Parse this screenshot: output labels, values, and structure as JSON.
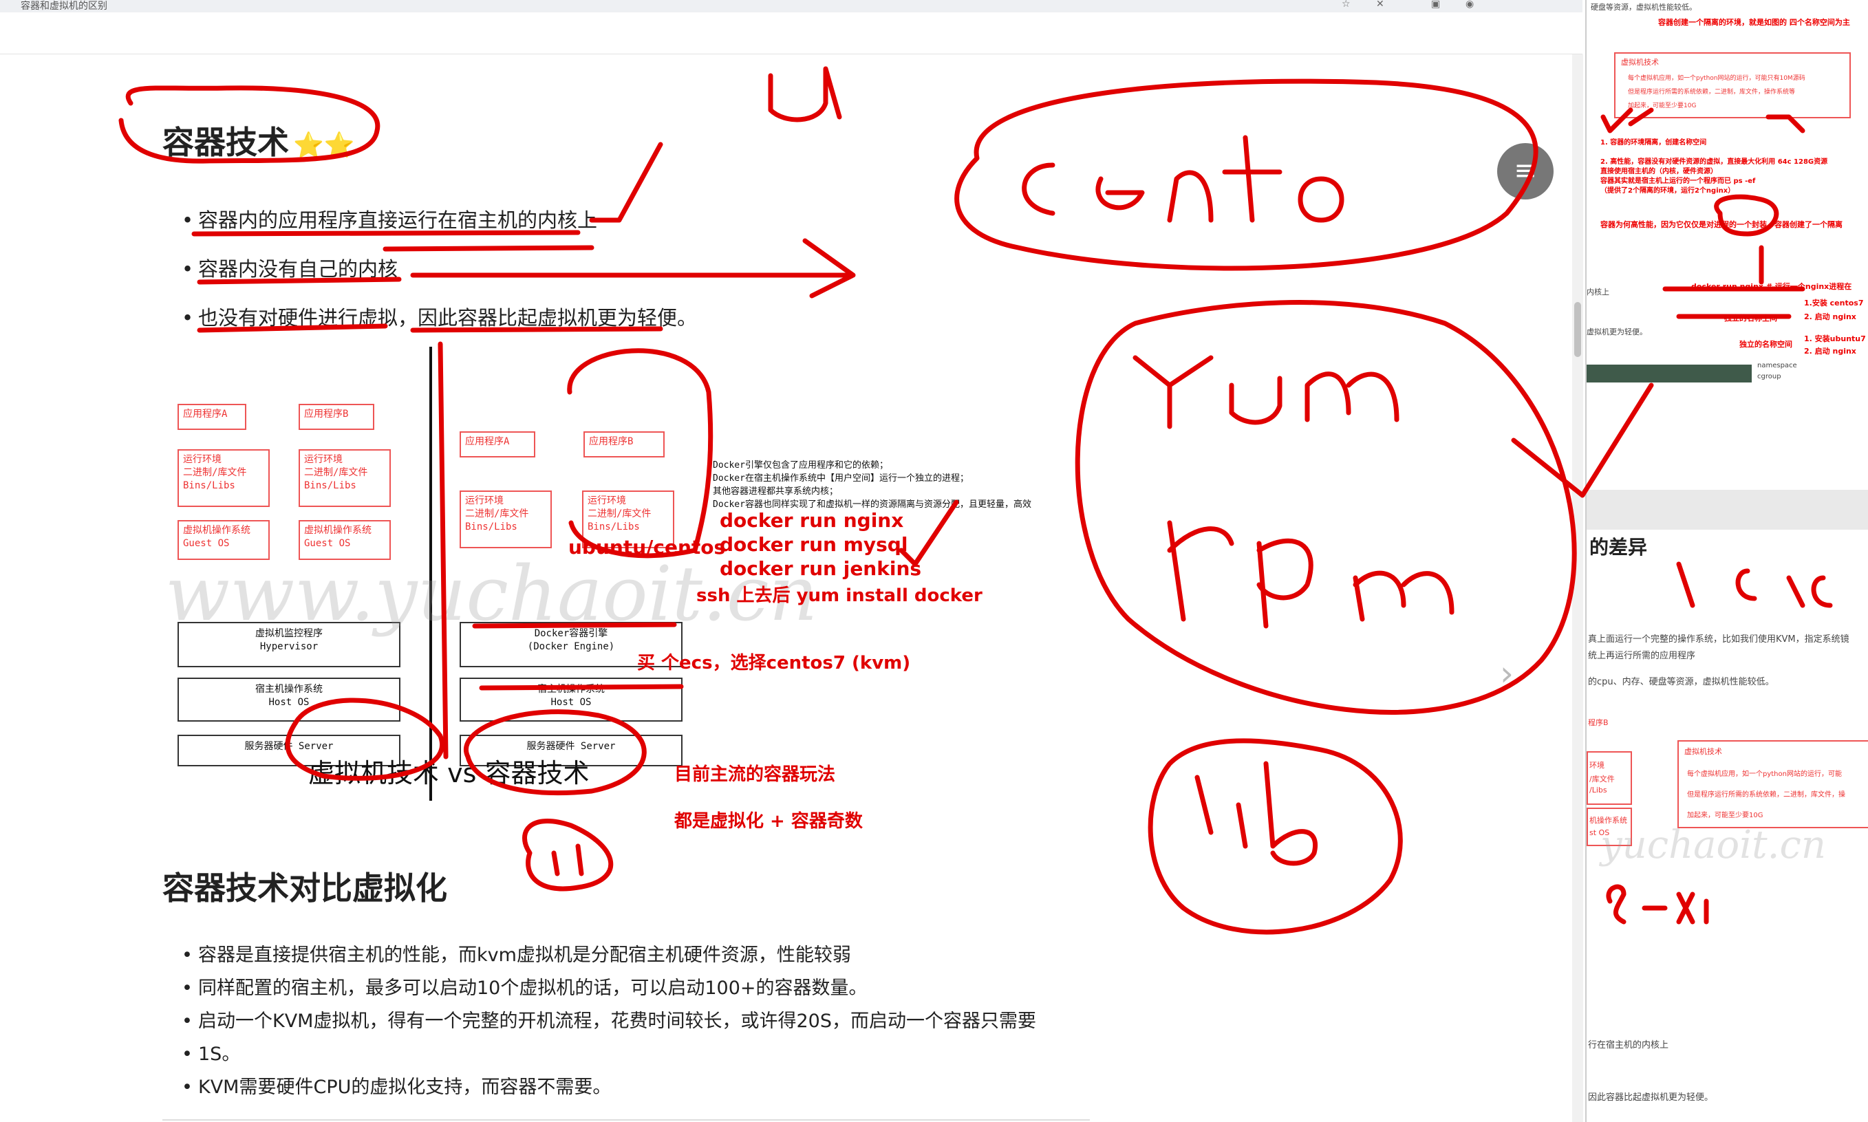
{
  "browser": {
    "tab_title": "容器和虚拟机的区别",
    "icons": [
      "star-icon",
      "close-icon",
      "extension-icon",
      "profile-icon"
    ]
  },
  "section1": {
    "title": "容器技术",
    "stars": "⭐⭐",
    "bullets": [
      "容器内的应用程序直接运行在宿主机的内核上",
      "容器内没有自己的内核",
      "也没有对硬件进行虚拟，因此容器比起虚拟机更为轻便。"
    ]
  },
  "diagram": {
    "left": {
      "app_a": "应用程序A",
      "app_b": "应用程序B",
      "env_a": [
        "运行环境",
        "二进制/库文件",
        "Bins/Libs"
      ],
      "env_b": [
        "运行环境",
        "二进制/库文件",
        "Bins/Libs"
      ],
      "guest_a": [
        "虚拟机操作系统",
        "Guest OS"
      ],
      "guest_b": [
        "虚拟机操作系统",
        "Guest OS"
      ],
      "hypervisor": [
        "虚拟机监控程序",
        "Hypervisor"
      ],
      "host": [
        "宿主机操作系统",
        "Host OS"
      ],
      "server": "服务器硬件 Server"
    },
    "right": {
      "app_a": "应用程序A",
      "app_b": "应用程序B",
      "env_a": [
        "运行环境",
        "二进制/库文件",
        "Bins/Libs"
      ],
      "env_b": [
        "运行环境",
        "二进制/库文件",
        "Bins/Libs"
      ],
      "engine": [
        "Docker容器引擎",
        "(Docker Engine)"
      ],
      "host": [
        "宿主机操作系统",
        "Host OS"
      ],
      "server": "服务器硬件 Server"
    },
    "notes": [
      "Docker引擎仅包含了应用程序和它的依赖；",
      "Docker在宿主机操作系统中【用户空间】运行一个独立的进程；",
      "其他容器进程都共享系统内核；",
      "Docker容器也同样实现了和虚拟机一样的资源隔离与资源分配，且更轻量，高效"
    ],
    "caption": "虚拟机技术 vs 容器技术",
    "watermark": "www.yuchaoit.cn"
  },
  "annotations": {
    "ubuntu": "ubuntu/centos",
    "cmds": [
      "docker run nginx",
      "docker run mysql",
      "docker run jenkins"
    ],
    "ssh": "ssh 上去后  yum install docker",
    "buy": "买 个ecs，选择centos7  (kvm)",
    "mainstream": "目前主流的容器玩法",
    "virt": "都是虚拟化 + 容器奇数",
    "hand_centos": "centos",
    "hand_yum": "yum",
    "hand_rpm": "rpm",
    "hand_lib": "lib",
    "hand_u": "u",
    "hand_esxi": "esxi"
  },
  "section2": {
    "title": "容器技术对比虚拟化",
    "bullets": [
      "容器是直接提供宿主机的性能，而kvm虚拟机是分配宿主机硬件资源，性能较弱",
      "同样配置的宿主机，最多可以启动10个虚拟机的话，可以启动100+的容器数量。",
      "启动一个KVM虚拟机，得有一个完整的开机流程，花费时间较长，或许得20S，而启动一个容器只需要",
      "1S。",
      "KVM需要硬件CPU的虚拟化支持，而容器不需要。"
    ]
  },
  "sidepanel": {
    "top_line": "硬盘等资源，虚拟机性能较低。",
    "red_line1": "容器创建一个隔离的环境，就是如图的 四个名称空间为主",
    "vm_title": "虚拟机技术",
    "vm_lines": [
      "每个虚拟机应用，如一个python网站的运行，可能只有10M源码",
      "但是程序运行所需的系统依赖，二进制，库文件，操作系统等",
      "加起来，可能至少要10G"
    ],
    "red_items": [
      "1. 容器的环境隔离，创建名称空间",
      "2. 高性能，容器没有对硬件资源的虚拟，直接最大化利用 64c 128G资源",
      "直接使用宿主机的（内核，硬件资源）",
      "容器其实就是宿主机上运行的一个程序而已 ps -ef",
      "（提供了2个隔离的环境，运行2个nginx）"
    ],
    "red_line2": "容器为何高性能，因为它仅仅是对进程的一个封装，容器创建了一个隔离",
    "docker_run": "docker  run nginx  # 运行一个nginx进程在",
    "install_centos": "1.安装 centos7",
    "start_nginx": "2. 启动  nginx",
    "install_ubuntu": "1. 安装ubuntu7",
    "start_nginx2": "2. 启动  nginx",
    "ns_label": "独立的名称空间",
    "ns_label2": "独立的名称空间",
    "kernel_line": "内核上",
    "lighter_line": "虚拟机更为轻便。",
    "namespace": "namespace",
    "cgroup": "cgroup",
    "diff_title": "的差异",
    "diff_lines": [
      "真上面运行一个完整的操作系统，比如我们使用KVM，指定系统镜",
      "统上再运行所需的应用程序"
    ],
    "cpu_line": "的cpu、内存、硬盘等资源，虚拟机性能较低。",
    "side_boxes": [
      "程序B",
      "环境",
      "/库文件",
      "/Libs",
      "机操作系统",
      "st OS"
    ],
    "vm_title2": "虚拟机技术",
    "vm_lines2": [
      "每个虚拟机应用，如一个python网站的运行，可能",
      "但是程序运行所需的系统依赖，二进制，库文件，操",
      "加起来，可能至少要10G"
    ],
    "bottom_line1": "行在宿主机的内核上",
    "bottom_line2": "因此容器比起虚拟机更为轻便。",
    "watermark": "yuchaoit.cn"
  }
}
